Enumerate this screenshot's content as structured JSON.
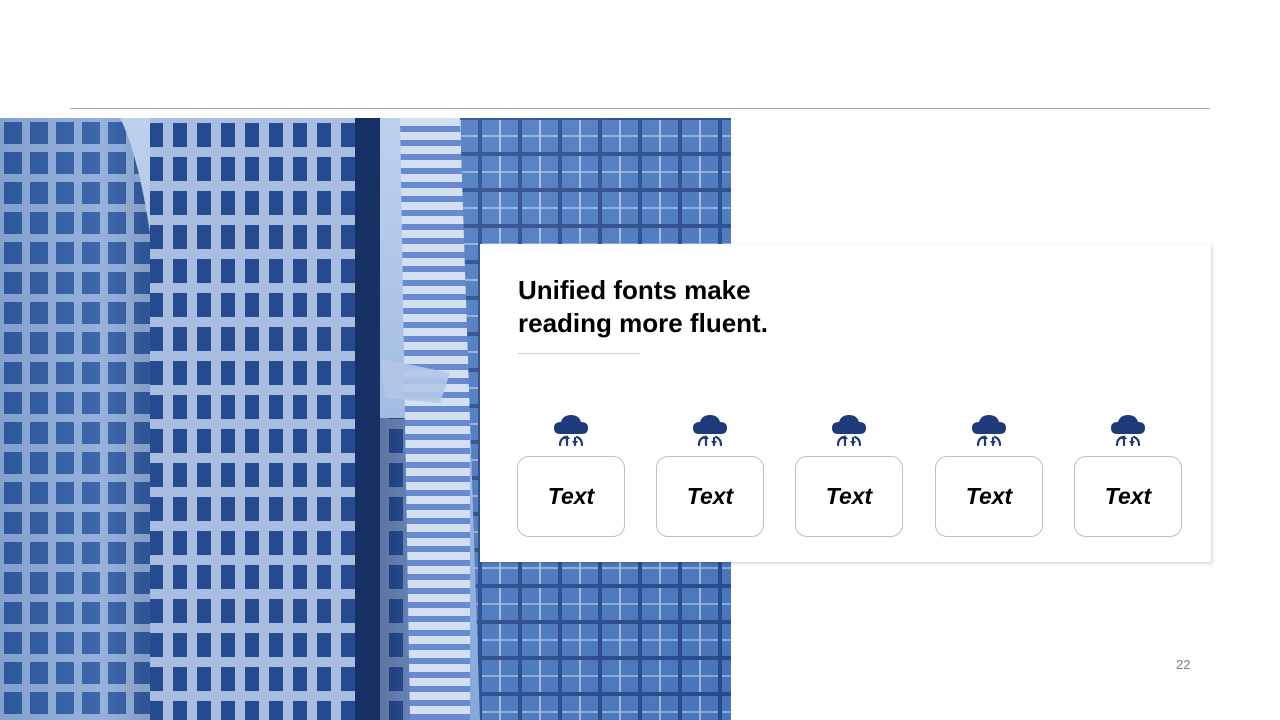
{
  "slide": {
    "title": "Unified fonts make reading more fluent.",
    "page_number": "22"
  },
  "items": [
    {
      "label": "Text",
      "icon": "cloud-network-icon"
    },
    {
      "label": "Text",
      "icon": "cloud-network-icon"
    },
    {
      "label": "Text",
      "icon": "cloud-network-icon"
    },
    {
      "label": "Text",
      "icon": "cloud-network-icon"
    },
    {
      "label": "Text",
      "icon": "cloud-network-icon"
    }
  ],
  "colors": {
    "accent": "#1f3a7a",
    "photo_tint": "#3f6db3",
    "rule": "#a6a6a6"
  }
}
